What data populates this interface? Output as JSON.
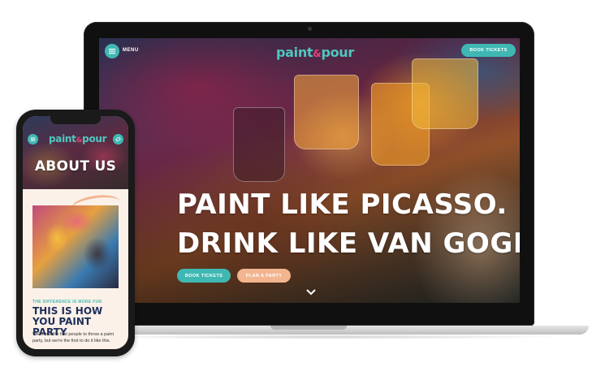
{
  "laptop": {
    "header": {
      "menu_label": "MENU",
      "logo_text_a": "paint",
      "logo_text_amp": "&",
      "logo_text_b": "pour",
      "book_button": "BOOK TICKETS"
    },
    "hero": {
      "line1": "PAINT LIKE PICASSO.",
      "line2": "DRINK LIKE VAN GOGH."
    },
    "cta": {
      "book_label": "BOOK TICKETS",
      "plan_label": "PLAN A PARTY"
    }
  },
  "phone": {
    "header": {
      "logo_text_a": "paint",
      "logo_text_amp": "&",
      "logo_text_b": "pour"
    },
    "hero_title": "ABOUT US",
    "section": {
      "eyebrow": "THE DIFFERENCE IS MORE FUN",
      "heading": "THIS IS HOW YOU PAINT PARTY",
      "body": "We're not the first people to throw a paint party, but we're the first to do it like this."
    }
  },
  "colors": {
    "accent_teal": "#3fb8b3",
    "accent_peach": "#f2b58f",
    "accent_pink": "#e2427a",
    "heading_navy": "#1d2f5c"
  },
  "icons": {
    "menu": "hamburger-icon",
    "scroll": "chevron-down-icon",
    "ticket": "ticket-icon"
  }
}
